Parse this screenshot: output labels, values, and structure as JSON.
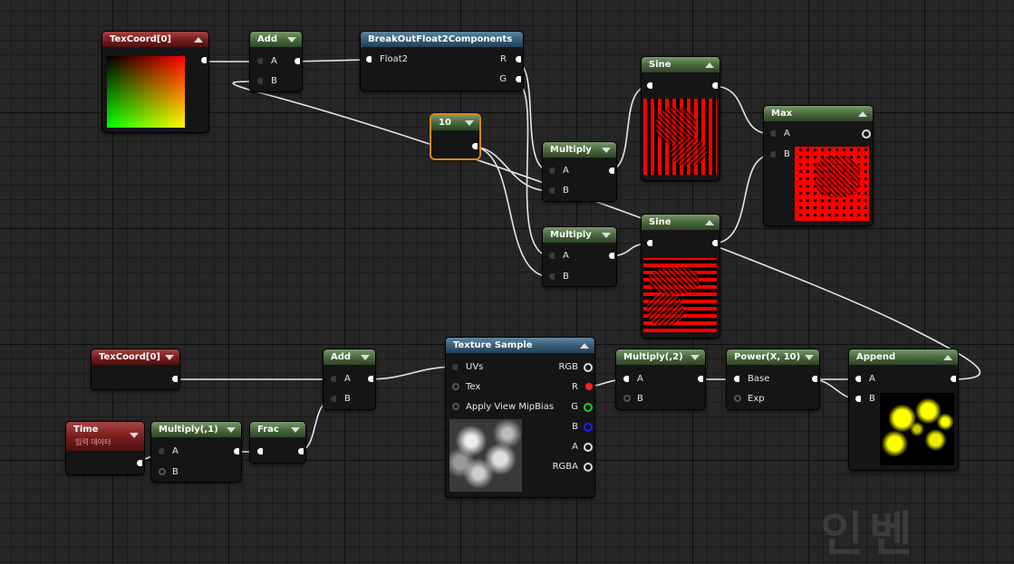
{
  "nodes": {
    "texcoord_top": {
      "title": "TexCoord[0]"
    },
    "add_top": {
      "title": "Add",
      "pin_a": "A",
      "pin_b": "B"
    },
    "breakout": {
      "title": "BreakOutFloat2Components",
      "pin_in": "Float2",
      "pin_r": "R",
      "pin_g": "G"
    },
    "const10": {
      "title": "10"
    },
    "multiply_1": {
      "title": "Multiply",
      "pin_a": "A",
      "pin_b": "B"
    },
    "multiply_2": {
      "title": "Multiply",
      "pin_a": "A",
      "pin_b": "B"
    },
    "sine_1": {
      "title": "Sine"
    },
    "sine_2": {
      "title": "Sine"
    },
    "max": {
      "title": "Max",
      "pin_a": "A",
      "pin_b": "B"
    },
    "texcoord_bottom": {
      "title": "TexCoord[0]"
    },
    "time": {
      "title": "Time",
      "subtitle": "입력 데이터"
    },
    "multiply_time": {
      "title": "Multiply(,1)",
      "pin_a": "A",
      "pin_b": "B"
    },
    "frac": {
      "title": "Frac"
    },
    "add_bottom": {
      "title": "Add",
      "pin_a": "A",
      "pin_b": "B"
    },
    "texture_sample": {
      "title": "Texture Sample",
      "inputs": [
        "UVs",
        "Tex",
        "Apply View MipBias"
      ],
      "outputs": [
        "RGB",
        "R",
        "G",
        "B",
        "A",
        "RGBA"
      ]
    },
    "multiply_2x": {
      "title": "Multiply(,2)",
      "pin_a": "A",
      "pin_b": "B"
    },
    "power": {
      "title": "Power(X, 10)",
      "pin_base": "Base",
      "pin_exp": "Exp"
    },
    "append": {
      "title": "Append",
      "pin_a": "A",
      "pin_b": "B"
    }
  },
  "colors": {
    "header_green": "#4a6a3e",
    "header_red": "#7a1e1e",
    "header_blue": "#3a5e7a",
    "selection": "#d48a1c",
    "wire": "#e6e6e6",
    "pin_r": "#ff2020",
    "pin_g": "#22cc22",
    "pin_b": "#2020ff"
  },
  "watermark": "인벤"
}
